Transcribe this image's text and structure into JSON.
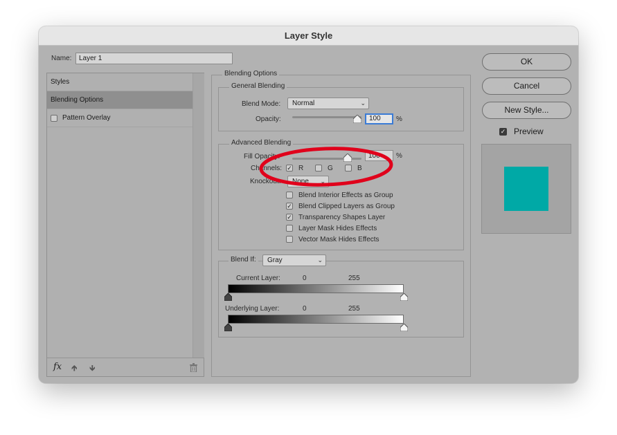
{
  "window": {
    "title": "Layer Style"
  },
  "name_field": {
    "label": "Name:",
    "value": "Layer 1"
  },
  "styles_panel": {
    "items": [
      {
        "label": "Styles",
        "selected": false,
        "has_checkbox": false
      },
      {
        "label": "Blending Options",
        "selected": true,
        "has_checkbox": false
      },
      {
        "label": "Pattern Overlay",
        "selected": false,
        "has_checkbox": true,
        "checked": false
      }
    ],
    "footer_fx": "fx"
  },
  "blending_options": {
    "title": "Blending Options",
    "general": {
      "title": "General Blending",
      "blend_mode_label": "Blend Mode:",
      "blend_mode_value": "Normal",
      "opacity_label": "Opacity:",
      "opacity_value": "100",
      "opacity_unit": "%"
    },
    "advanced": {
      "title": "Advanced Blending",
      "fill_opacity_label": "Fill Opacity:",
      "fill_opacity_value": "100",
      "fill_opacity_unit": "%",
      "channels_label": "Channels:",
      "channels": [
        {
          "label": "R",
          "checked": true
        },
        {
          "label": "G",
          "checked": false
        },
        {
          "label": "B",
          "checked": false
        }
      ],
      "knockout_label": "Knockout:",
      "knockout_value": "None",
      "options": [
        {
          "label": "Blend Interior Effects as Group",
          "checked": false
        },
        {
          "label": "Blend Clipped Layers as Group",
          "checked": true
        },
        {
          "label": "Transparency Shapes Layer",
          "checked": true
        },
        {
          "label": "Layer Mask Hides Effects",
          "checked": false
        },
        {
          "label": "Vector Mask Hides Effects",
          "checked": false
        }
      ]
    },
    "blend_if": {
      "label": "Blend If:",
      "value": "Gray",
      "current_layer": {
        "label": "Current Layer:",
        "low": "0",
        "high": "255"
      },
      "underlying_layer": {
        "label": "Underlying Layer:",
        "low": "0",
        "high": "255"
      }
    }
  },
  "buttons": {
    "ok": "OK",
    "cancel": "Cancel",
    "new_style": "New Style...",
    "preview_label": "Preview",
    "preview_checked": true
  },
  "colors": {
    "preview_swatch": "#00a9a6",
    "annotation": "#e0001b"
  }
}
